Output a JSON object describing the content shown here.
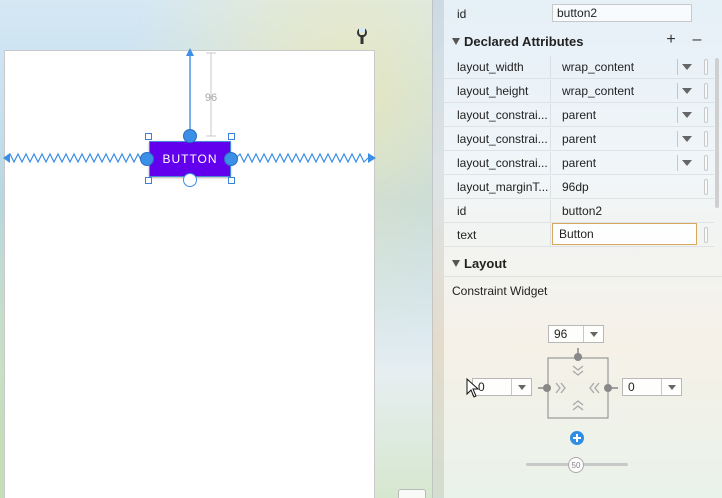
{
  "design": {
    "button_text": "BUTTON",
    "margin_top_label": "96"
  },
  "attributes": {
    "id_row": {
      "name": "id",
      "value": "button2"
    },
    "declared_header": "Declared Attributes",
    "add_label": "+",
    "remove_label": "–",
    "rows": [
      {
        "name": "layout_width",
        "value": "wrap_content"
      },
      {
        "name": "layout_height",
        "value": "wrap_content"
      },
      {
        "name": "layout_constrai...",
        "value": "parent"
      },
      {
        "name": "layout_constrai...",
        "value": "parent"
      },
      {
        "name": "layout_constrai...",
        "value": "parent"
      },
      {
        "name": "layout_marginT...",
        "value": "96dp"
      },
      {
        "name": "id",
        "value": "button2"
      },
      {
        "name": "text",
        "value": "Button"
      }
    ],
    "layout_header": "Layout",
    "constraint_widget_label": "Constraint Widget"
  },
  "constraint_widget": {
    "top_margin": "96",
    "left_margin": "0",
    "right_margin": "0",
    "bias": "50"
  },
  "colors": {
    "accent_button": "#6200ee",
    "anchor_blue": "#3b8fe6",
    "focus_border": "#d8a860"
  },
  "icons": [
    "wrench-icon",
    "plus-icon",
    "minus-icon",
    "chevron-down-icon",
    "add-constraint-icon",
    "cursor-icon"
  ]
}
